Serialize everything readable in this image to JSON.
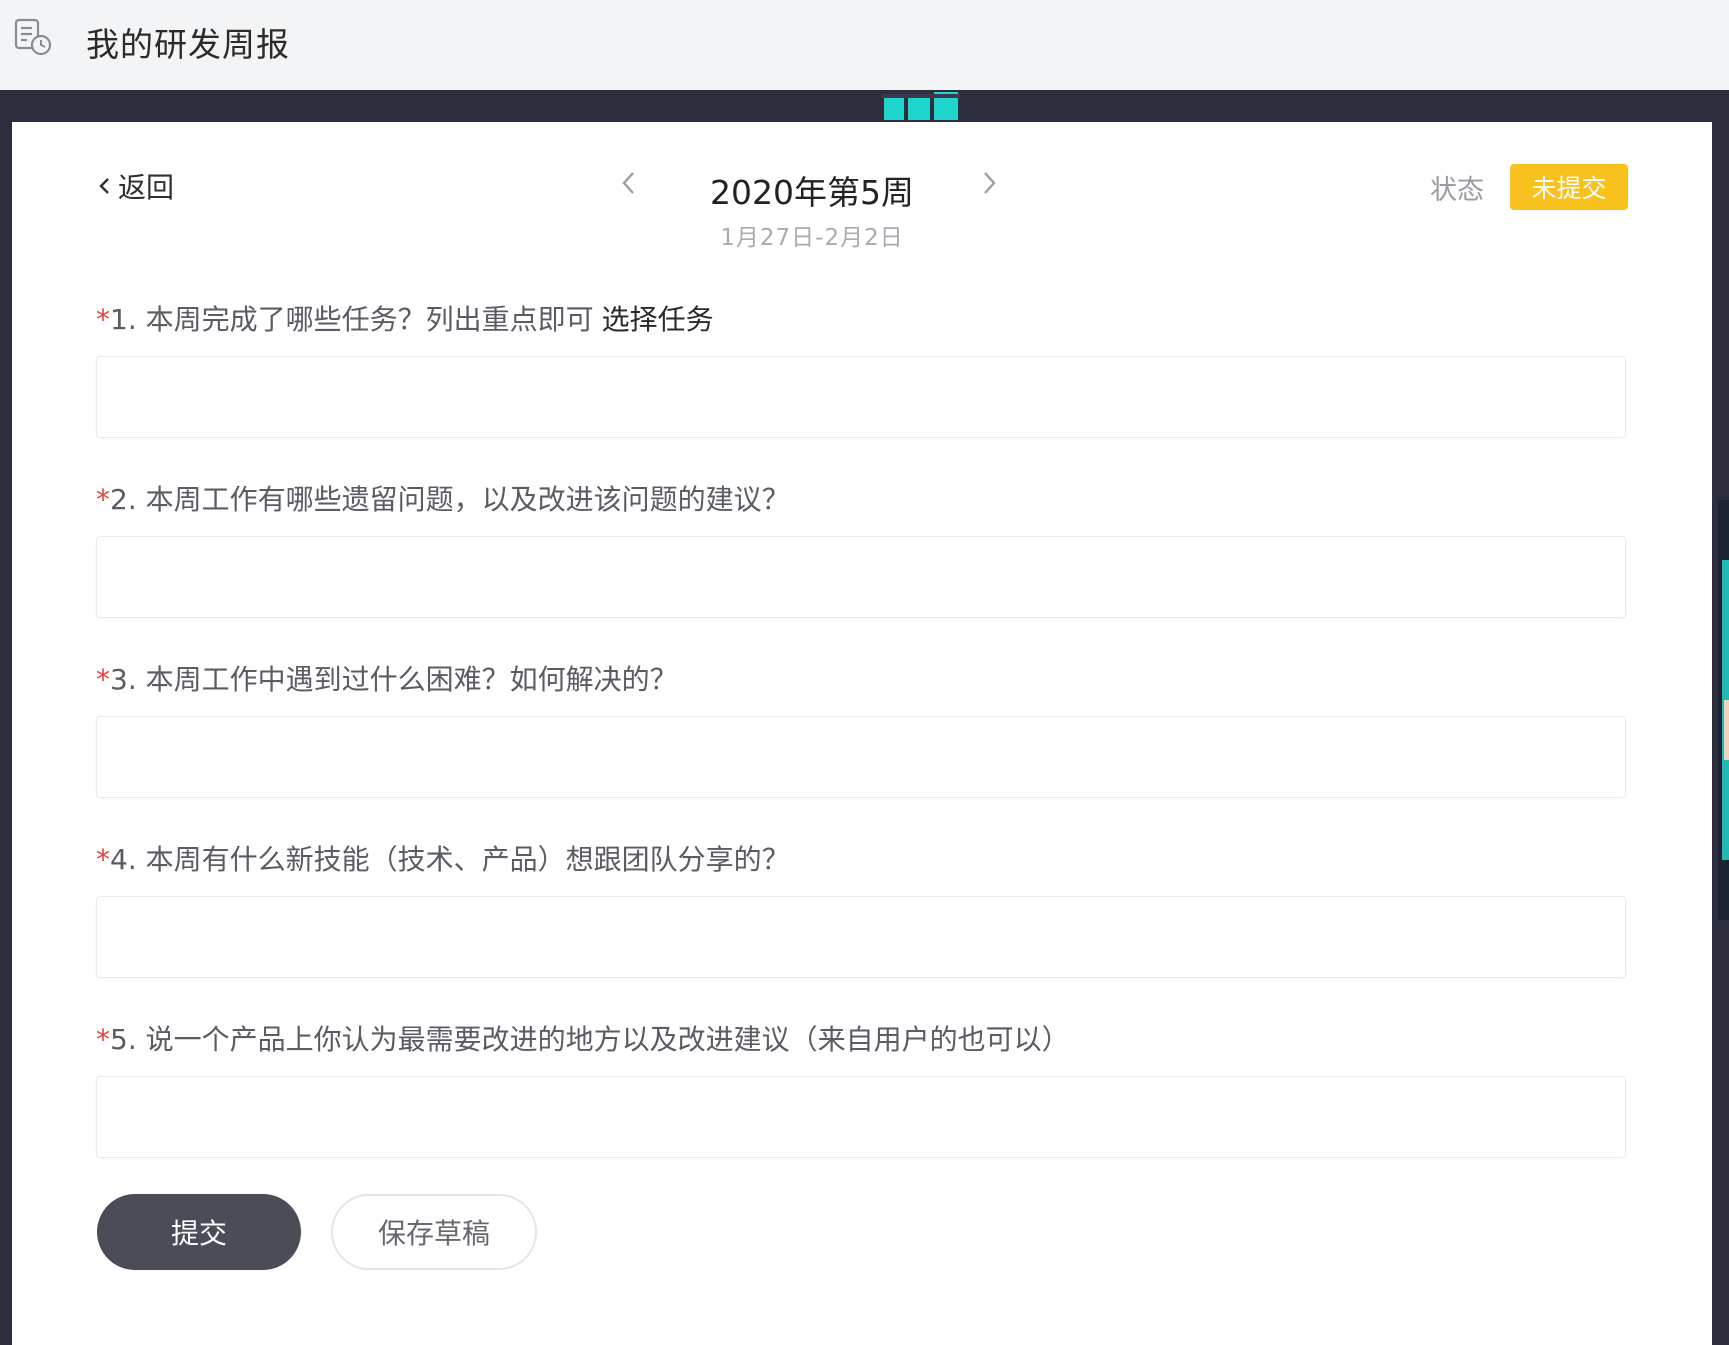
{
  "app": {
    "title": "我的研发周报",
    "icon": "report-clock-icon"
  },
  "header": {
    "back_label": "返回",
    "week_title": "2020年第5周",
    "week_range": "1月27日-2月2日",
    "status_label": "状态",
    "status_value": "未提交",
    "status_color": "#f9c11e"
  },
  "form": {
    "required_mark": "*",
    "questions": [
      {
        "label": "1. 本周完成了哪些任务？列出重点即可",
        "link": "选择任务",
        "value": ""
      },
      {
        "label": "2. 本周工作有哪些遗留问题，以及改进该问题的建议？",
        "value": ""
      },
      {
        "label": "3. 本周工作中遇到过什么困难？如何解决的？",
        "value": ""
      },
      {
        "label": "4. 本周有什么新技能（技术、产品）想跟团队分享的？",
        "value": ""
      },
      {
        "label": "5. 说一个产品上你认为最需要改进的地方以及改进建议（来自用户的也可以）",
        "value": ""
      }
    ]
  },
  "actions": {
    "submit_label": "提交",
    "draft_label": "保存草稿"
  },
  "colors": {
    "accent_dark": "#4a4d57",
    "required": "#e5413b",
    "deco_teal": "#1fd6cf"
  }
}
